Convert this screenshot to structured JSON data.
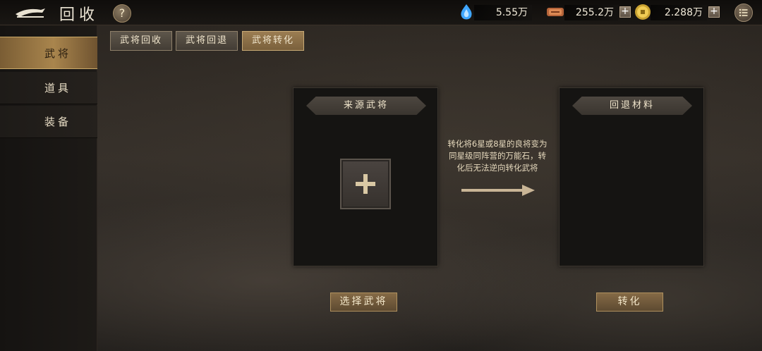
{
  "header": {
    "title": "回收",
    "help_label": "?"
  },
  "resources": [
    {
      "name": "jade",
      "value": "5.55万"
    },
    {
      "name": "copper",
      "value": "255.2万"
    },
    {
      "name": "gold",
      "value": "2.288万"
    }
  ],
  "plus_label": "+",
  "sidebar": {
    "items": [
      {
        "label": "武将",
        "active": true
      },
      {
        "label": "道具",
        "active": false
      },
      {
        "label": "装备",
        "active": false
      }
    ]
  },
  "tabs": [
    {
      "label": "武将回收",
      "active": false
    },
    {
      "label": "武将回退",
      "active": false
    },
    {
      "label": "武将转化",
      "active": true
    }
  ],
  "source_panel": {
    "title": "来源武将",
    "add_label": "+"
  },
  "result_panel": {
    "title": "回退材料"
  },
  "description": "转化将6星或8星的良将变为同星级同阵营的万能石，转化后无法逆向转化武将",
  "buttons": {
    "select": "选择武将",
    "convert": "转化"
  },
  "colors": {
    "accent": "#a9854d",
    "panel": "#151412",
    "text": "#e8dcc0"
  },
  "icons": [
    "back-icon",
    "help-icon",
    "jade-icon",
    "copper-icon",
    "gold-coin-icon",
    "menu-icon",
    "plus-icon",
    "arrow-right-icon"
  ]
}
